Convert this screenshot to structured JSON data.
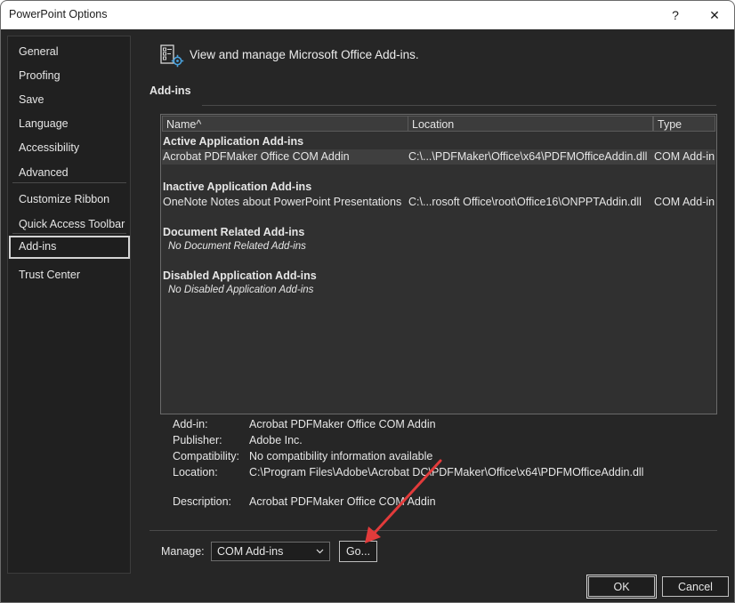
{
  "window": {
    "title": "PowerPoint Options",
    "help_glyph": "?",
    "close_glyph": "✕"
  },
  "sidebar": {
    "items": [
      {
        "label": "General"
      },
      {
        "label": "Proofing"
      },
      {
        "label": "Save"
      },
      {
        "label": "Language"
      },
      {
        "label": "Accessibility"
      },
      {
        "label": "Advanced"
      },
      {
        "label": "Customize Ribbon"
      },
      {
        "label": "Quick Access Toolbar"
      },
      {
        "label": "Add-ins",
        "selected": true
      },
      {
        "label": "Trust Center"
      }
    ]
  },
  "header": {
    "icon": "addins-settings-icon",
    "text": "View and manage Microsoft Office Add-ins."
  },
  "addins": {
    "section_title": "Add-ins",
    "columns": [
      "Name^",
      "Location",
      "Type"
    ],
    "groups": [
      {
        "title": "Active Application Add-ins",
        "rows": [
          {
            "name": "Acrobat PDFMaker Office COM Addin",
            "location": "C:\\...\\PDFMaker\\Office\\x64\\PDFMOfficeAddin.dll",
            "type": "COM Add-in",
            "selected": true
          }
        ]
      },
      {
        "title": "Inactive Application Add-ins",
        "rows": [
          {
            "name": "OneNote Notes about PowerPoint Presentations",
            "location": "C:\\...rosoft Office\\root\\Office16\\ONPPTAddin.dll",
            "type": "COM Add-in"
          }
        ]
      },
      {
        "title": "Document Related Add-ins",
        "empty_note": "No Document Related Add-ins"
      },
      {
        "title": "Disabled Application Add-ins",
        "empty_note": "No Disabled Application Add-ins"
      }
    ]
  },
  "details": {
    "addin_label": "Add-in:",
    "addin_value": "Acrobat PDFMaker Office COM Addin",
    "publisher_label": "Publisher:",
    "publisher_value": "Adobe Inc.",
    "compatibility_label": "Compatibility:",
    "compatibility_value": "No compatibility information available",
    "location_label": "Location:",
    "location_value": "C:\\Program Files\\Adobe\\Acrobat DC\\PDFMaker\\Office\\x64\\PDFMOfficeAddin.dll",
    "description_label": "Description:",
    "description_value": "Acrobat PDFMaker Office COM Addin"
  },
  "manage": {
    "label": "Manage:",
    "selected": "COM Add-ins",
    "go_label": "Go..."
  },
  "buttons": {
    "ok": "OK",
    "cancel": "Cancel"
  },
  "colors": {
    "annotation_arrow": "#e23b3b",
    "background": "#262626",
    "selection_outline": "#d4d4d4"
  }
}
